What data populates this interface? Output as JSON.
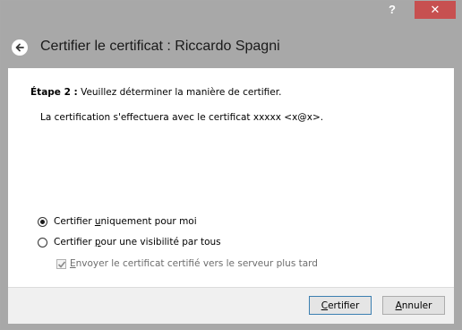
{
  "window": {
    "help_label": "?",
    "close_label": "✕"
  },
  "header": {
    "title": "Certifier le certificat : Riccardo Spagni",
    "back_icon": "back-arrow-icon"
  },
  "main": {
    "step_label": "Étape 2 :",
    "step_text": " Veuillez déterminer la manière de certifier.",
    "cert_text": "La certification s'effectuera avec le certificat xxxxx <x@x>.",
    "options": [
      {
        "pre": "Certifier ",
        "accel": "u",
        "post": "niquement pour moi",
        "checked": true
      },
      {
        "pre": "Certifier ",
        "accel": "p",
        "post": "our une visibilité par tous",
        "checked": false
      }
    ],
    "send_checkbox": {
      "accel": "E",
      "post": "nvoyer le certificat certifié vers le serveur plus tard",
      "checked": true,
      "enabled": false
    }
  },
  "footer": {
    "certify": {
      "accel": "C",
      "post": "ertifier"
    },
    "cancel": {
      "accel": "A",
      "post": "nnuler"
    }
  }
}
